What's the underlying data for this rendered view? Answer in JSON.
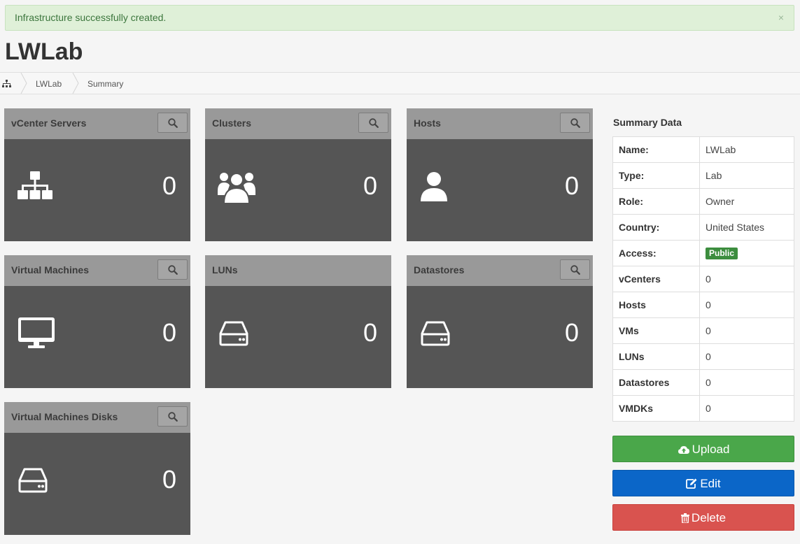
{
  "alert": {
    "message": "Infrastructure successfully created.",
    "close": "×"
  },
  "page": {
    "title": "LWLab"
  },
  "breadcrumb": {
    "items": [
      "LWLab",
      "Summary"
    ]
  },
  "panels": [
    {
      "title": "vCenter Servers",
      "count": "0",
      "icon": "sitemap-icon"
    },
    {
      "title": "Clusters",
      "count": "0",
      "icon": "users-icon"
    },
    {
      "title": "Hosts",
      "count": "0",
      "icon": "user-icon"
    },
    {
      "title": "Virtual Machines",
      "count": "0",
      "icon": "desktop-icon"
    },
    {
      "title": "LUNs",
      "count": "0",
      "icon": "hdd-icon"
    },
    {
      "title": "Datastores",
      "count": "0",
      "icon": "hdd-icon"
    },
    {
      "title": "Virtual Machines Disks",
      "count": "0",
      "icon": "hdd-icon"
    }
  ],
  "summary": {
    "title": "Summary Data",
    "rows": [
      {
        "key": "Name:",
        "value": "LWLab"
      },
      {
        "key": "Type:",
        "value": "Lab"
      },
      {
        "key": "Role:",
        "value": "Owner"
      },
      {
        "key": "Country:",
        "value": "United States"
      },
      {
        "key": "Access:",
        "value": "Public"
      },
      {
        "key": "vCenters",
        "value": "0"
      },
      {
        "key": "Hosts",
        "value": "0"
      },
      {
        "key": "VMs",
        "value": "0"
      },
      {
        "key": "LUNs",
        "value": "0"
      },
      {
        "key": "Datastores",
        "value": "0"
      },
      {
        "key": "VMDKs",
        "value": "0"
      }
    ]
  },
  "buttons": {
    "upload": "Upload",
    "edit": "Edit",
    "delete": "Delete"
  },
  "colors": {
    "alert_bg": "#dff0d8",
    "panel_head": "#999999",
    "panel_body": "#555555",
    "upload": "#4aa74a",
    "edit": "#0b66c8",
    "delete": "#d9534f",
    "public_badge": "#3c8d3e"
  }
}
